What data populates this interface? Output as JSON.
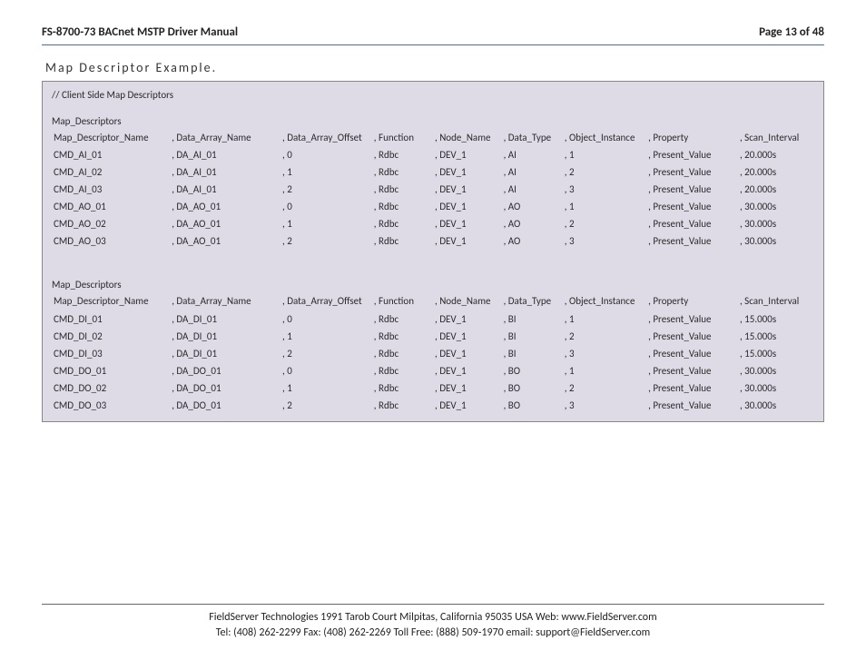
{
  "header": {
    "title": "FS-8700-73 BACnet MSTP Driver Manual",
    "page": "Page 13 of 48"
  },
  "section_title": "Map Descriptor Example.",
  "codebox": {
    "comment": "//    Client Side Map Descriptors",
    "block_label": "Map_Descriptors",
    "columns": [
      "Map_Descriptor_Name",
      ", Data_Array_Name",
      ", Data_Array_Offset",
      ", Function",
      ", Node_Name",
      ", Data_Type",
      ", Object_Instance",
      ", Property",
      ", Scan_Interval"
    ],
    "group1": [
      [
        "CMD_AI_01",
        ", DA_AI_01",
        ", 0",
        ", Rdbc",
        ", DEV_1",
        ", AI",
        ", 1",
        ", Present_Value",
        ", 20.000s"
      ],
      [
        "CMD_AI_02",
        ", DA_AI_01",
        ", 1",
        ", Rdbc",
        ", DEV_1",
        ", AI",
        ", 2",
        ", Present_Value",
        ", 20.000s"
      ],
      [
        "CMD_AI_03",
        ", DA_AI_01",
        ", 2",
        ", Rdbc",
        ", DEV_1",
        ", AI",
        ", 3",
        ", Present_Value",
        ", 20.000s"
      ],
      [
        "CMD_AO_01",
        ", DA_AO_01",
        ", 0",
        ", Rdbc",
        ", DEV_1",
        ", AO",
        ", 1",
        ", Present_Value",
        ", 30.000s"
      ],
      [
        "CMD_AO_02",
        ", DA_AO_01",
        ", 1",
        ", Rdbc",
        ", DEV_1",
        ", AO",
        ", 2",
        ", Present_Value",
        ", 30.000s"
      ],
      [
        "CMD_AO_03",
        ", DA_AO_01",
        ", 2",
        ", Rdbc",
        ", DEV_1",
        ", AO",
        ", 3",
        ", Present_Value",
        ", 30.000s"
      ]
    ],
    "group2": [
      [
        "CMD_DI_01",
        ", DA_DI_01",
        ", 0",
        ", Rdbc",
        ", DEV_1",
        ", BI",
        ", 1",
        ", Present_Value",
        ", 15.000s"
      ],
      [
        "CMD_DI_02",
        ", DA_DI_01",
        ", 1",
        ", Rdbc",
        ", DEV_1",
        ", BI",
        ", 2",
        ", Present_Value",
        ", 15.000s"
      ],
      [
        "CMD_DI_03",
        ", DA_DI_01",
        ", 2",
        ", Rdbc",
        ", DEV_1",
        ", BI",
        ", 3",
        ", Present_Value",
        ", 15.000s"
      ],
      [
        "CMD_DO_01",
        ", DA_DO_01",
        ", 0",
        ", Rdbc",
        ", DEV_1",
        ", BO",
        ", 1",
        ", Present_Value",
        ", 30.000s"
      ],
      [
        "CMD_DO_02",
        ", DA_DO_01",
        ", 1",
        ", Rdbc",
        ", DEV_1",
        ", BO",
        ", 2",
        ", Present_Value",
        ", 30.000s"
      ],
      [
        "CMD_DO_03",
        ", DA_DO_01",
        ", 2",
        ", Rdbc",
        ", DEV_1",
        ", BO",
        ", 3",
        ", Present_Value",
        ", 30.000s"
      ]
    ]
  },
  "footer": {
    "line1": "FieldServer Technologies 1991 Tarob Court Milpitas, California 95035 USA   Web: www.FieldServer.com",
    "line2": "Tel: (408) 262-2299   Fax: (408) 262-2269   Toll Free: (888) 509-1970   email: support@FieldServer.com"
  },
  "colwidths": [
    "15.5%",
    "14.5%",
    "12%",
    "8%",
    "9%",
    "8%",
    "11%",
    "12%",
    "10%"
  ]
}
